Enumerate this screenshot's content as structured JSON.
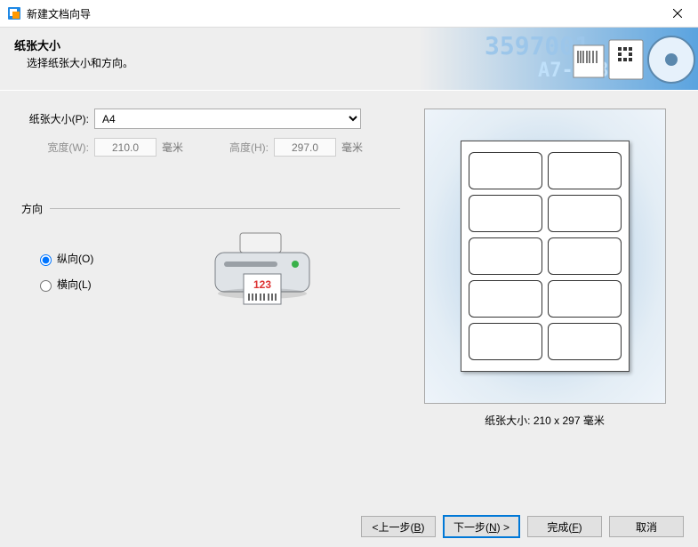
{
  "window": {
    "title": "新建文档向导"
  },
  "header": {
    "title": "纸张大小",
    "subtitle": "选择纸张大小和方向。"
  },
  "paper": {
    "size_label": "纸张大小(P):",
    "size_value": "A4",
    "width_label": "宽度(W):",
    "width_value": "210.0",
    "height_label": "高度(H):",
    "height_value": "297.0",
    "unit": "毫米"
  },
  "orientation": {
    "group_label": "方向",
    "portrait_label": "纵向(O)",
    "landscape_label": "横向(L)",
    "value": "portrait"
  },
  "preview": {
    "caption_prefix": "纸张大小:  ",
    "caption_value": "210 x 297 毫米"
  },
  "buttons": {
    "back_pre": "<上一步(",
    "back_key": "B",
    "back_post": ")",
    "next_pre": "下一步(",
    "next_key": "N",
    "next_post": ") >",
    "finish_pre": "完成(",
    "finish_key": "F",
    "finish_post": ")",
    "cancel": "取消"
  }
}
